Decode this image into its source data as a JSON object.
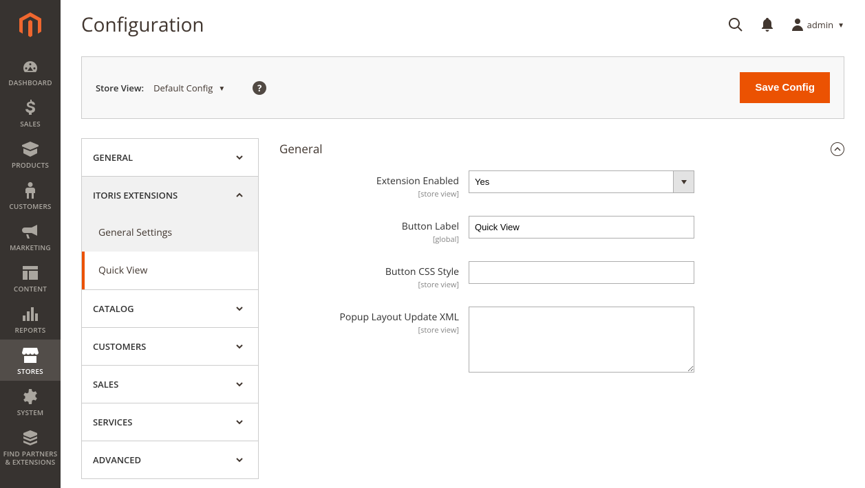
{
  "header": {
    "title": "Configuration",
    "admin_user": "admin"
  },
  "toolbar": {
    "store_view_label": "Store View:",
    "store_view_value": "Default Config",
    "save_label": "Save Config"
  },
  "sidebar_nav": [
    {
      "id": "dashboard",
      "label": "DASHBOARD"
    },
    {
      "id": "sales",
      "label": "SALES"
    },
    {
      "id": "products",
      "label": "PRODUCTS"
    },
    {
      "id": "customers",
      "label": "CUSTOMERS"
    },
    {
      "id": "marketing",
      "label": "MARKETING"
    },
    {
      "id": "content",
      "label": "CONTENT"
    },
    {
      "id": "reports",
      "label": "REPORTS"
    },
    {
      "id": "stores",
      "label": "STORES",
      "active": true
    },
    {
      "id": "system",
      "label": "SYSTEM"
    },
    {
      "id": "find_partners",
      "label": "FIND PARTNERS & EXTENSIONS"
    }
  ],
  "config_tabs": [
    {
      "label": "GENERAL",
      "expanded": false
    },
    {
      "label": "ITORIS EXTENSIONS",
      "expanded": true,
      "children": [
        {
          "label": "General Settings",
          "active": false
        },
        {
          "label": "Quick View",
          "active": true
        }
      ]
    },
    {
      "label": "CATALOG",
      "expanded": false
    },
    {
      "label": "CUSTOMERS",
      "expanded": false
    },
    {
      "label": "SALES",
      "expanded": false
    },
    {
      "label": "SERVICES",
      "expanded": false
    },
    {
      "label": "ADVANCED",
      "expanded": false
    }
  ],
  "form": {
    "section_title": "General",
    "fields": {
      "extension_enabled": {
        "label": "Extension Enabled",
        "scope": "[store view]",
        "value": "Yes"
      },
      "button_label": {
        "label": "Button Label",
        "scope": "[global]",
        "value": "Quick View"
      },
      "button_css_style": {
        "label": "Button CSS Style",
        "scope": "[store view]",
        "value": ""
      },
      "popup_layout": {
        "label": "Popup Layout Update XML",
        "scope": "[store view]",
        "value": ""
      }
    }
  }
}
